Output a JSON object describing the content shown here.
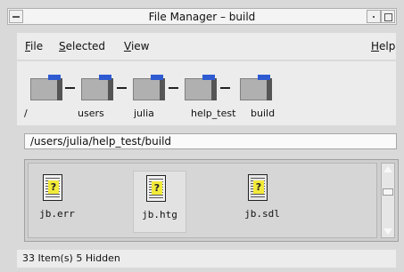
{
  "window": {
    "title": "File Manager – build"
  },
  "menu": {
    "file": {
      "mnemonic": "F",
      "rest": "ile"
    },
    "selected": {
      "mnemonic": "S",
      "rest": "elected"
    },
    "view": {
      "mnemonic": "V",
      "rest": "iew"
    },
    "help": {
      "mnemonic": "H",
      "rest": "elp"
    }
  },
  "path_folders": [
    {
      "label": "/"
    },
    {
      "label": "users"
    },
    {
      "label": "julia"
    },
    {
      "label": "help_test"
    },
    {
      "label": "build"
    }
  ],
  "location": {
    "value": "/users/julia/help_test/build"
  },
  "files": [
    {
      "name": "jb.err"
    },
    {
      "name": "jb.htg",
      "selected": true
    },
    {
      "name": "jb.sdl"
    }
  ],
  "status": {
    "text": "33 Item(s) 5 Hidden"
  },
  "colors": {
    "folder_tab": "#2f5bd2",
    "help_icon": "#f2ea3a"
  }
}
